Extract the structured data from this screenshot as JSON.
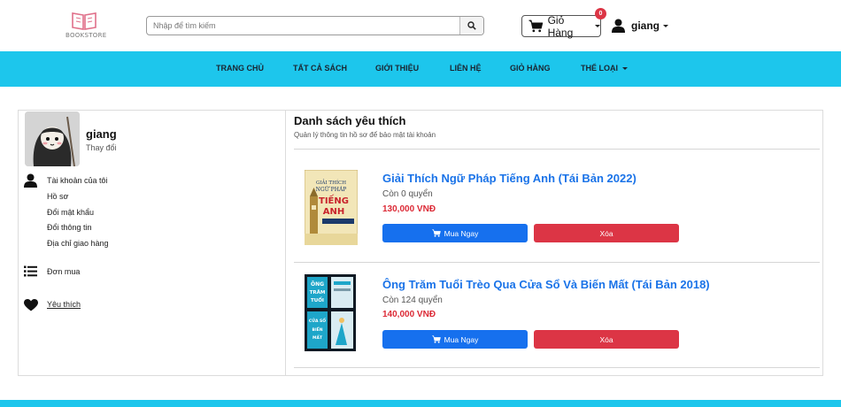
{
  "header": {
    "logo_text": "BOOKSTORE",
    "search_placeholder": "Nhập để tìm kiếm",
    "cart_label": "Giỏ Hàng",
    "cart_count": "0",
    "username": "giang"
  },
  "nav": {
    "items": [
      "TRANG CHỦ",
      "TẤT CẢ SÁCH",
      "GIỚI THIỆU",
      "LIÊN HỆ",
      "GIỎ HÀNG",
      "THỂ LOẠI"
    ]
  },
  "profile": {
    "name": "giang",
    "change_label": "Thay đổi"
  },
  "sidebar": {
    "account_label": "Tài khoản của tôi",
    "account_links": [
      "Hồ sơ",
      "Đổi mật khẩu",
      "Đổi thông tin",
      "Địa chỉ giao hàng"
    ],
    "orders_label": "Đơn mua",
    "favorites_label": "Yêu thích"
  },
  "wishlist": {
    "title": "Danh sách yêu thích",
    "subtitle": "Quản lý thông tin hồ sơ để bảo mật tài khoản",
    "buy_label": "Mua Ngay",
    "delete_label": "Xóa",
    "books": [
      {
        "title": "Giải Thích Ngữ Pháp Tiếng Anh (Tái Bản 2022)",
        "stock": "Còn 0 quyển",
        "price": "130,000 VNĐ"
      },
      {
        "title": "Ông Trăm Tuổi Trèo Qua Cửa Sổ Và Biến Mất (Tái Bản 2018)",
        "stock": "Còn 124 quyển",
        "price": "140,000 VNĐ"
      }
    ]
  },
  "colors": {
    "nav_bg": "#1dc6ec",
    "link": "#1a73e8",
    "price": "#dc2a36",
    "buy_button": "#1670ee",
    "delete_button": "#dc3545"
  }
}
